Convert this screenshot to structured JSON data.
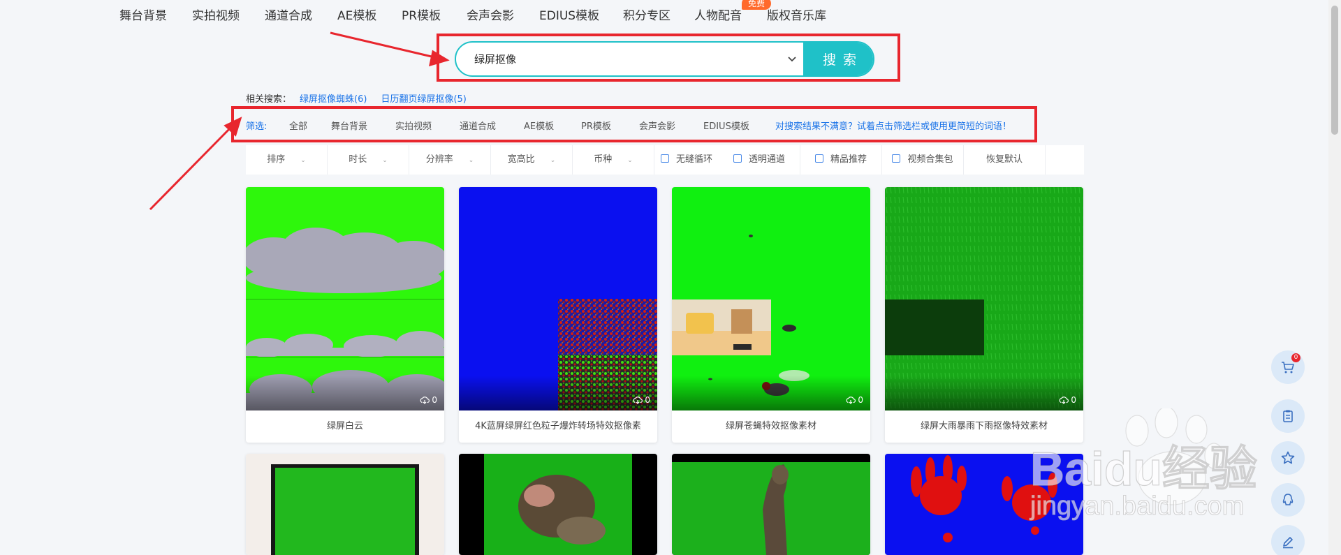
{
  "nav": {
    "items": [
      "舞台背景",
      "实拍视频",
      "通道合成",
      "AE模板",
      "PR模板",
      "会声会影",
      "EDIUS模板",
      "积分专区",
      "人物配音",
      "版权音乐库"
    ],
    "free_badge": "免费"
  },
  "search": {
    "value": "绿屏抠像",
    "button": "搜索"
  },
  "related": {
    "label": "相关搜索：",
    "links": [
      "绿屏抠像蜘蛛(6)",
      "日历翻页绿屏抠像(5)"
    ]
  },
  "filter": {
    "label": "筛选:",
    "items": [
      "全部",
      "舞台背景",
      "实拍视频",
      "通道合成",
      "AE模板",
      "PR模板",
      "会声会影",
      "EDIUS模板"
    ],
    "tip": "对搜索结果不满意？试着点击筛选栏或使用更简短的词语！"
  },
  "sortbar": {
    "dropdowns": [
      "排序",
      "时长",
      "分辨率",
      "宽高比",
      "币种"
    ],
    "checkboxes": [
      "无缝循环",
      "透明通道",
      "精品推荐",
      "视频合集包"
    ],
    "reset": "恢复默认"
  },
  "cards": [
    {
      "title": "绿屏白云",
      "downloads": "0"
    },
    {
      "title": "4K蓝屏绿屏红色粒子爆炸转场特效抠像素",
      "downloads": "0"
    },
    {
      "title": "绿屏苍蝇特效抠像素材",
      "downloads": "0"
    },
    {
      "title": "绿屏大雨暴雨下雨抠像特效素材",
      "downloads": "0"
    }
  ],
  "cart_count": "0",
  "watermark": {
    "brand": "Baidu经验",
    "url": "jingyan.baidu.com"
  },
  "colors": {
    "accent": "#1fc1c8",
    "link": "#1a73e8",
    "annotation": "#e8262e",
    "badge": "#ff6a2b"
  }
}
